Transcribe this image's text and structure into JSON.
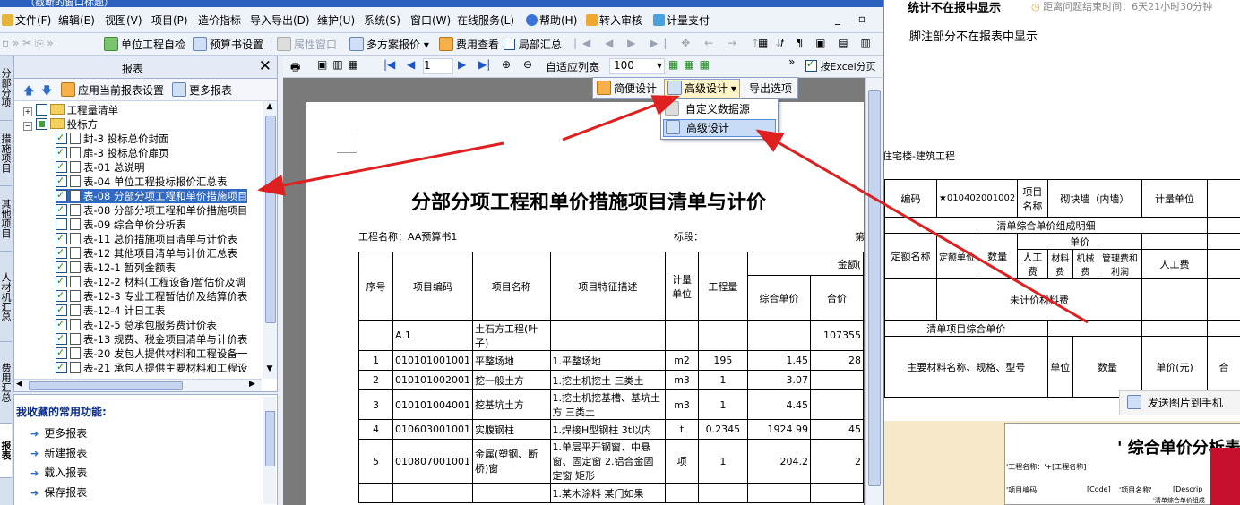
{
  "window": {
    "title": "（截断的窗口标题）"
  },
  "menu": {
    "items": [
      "文件(F)",
      "编辑(E)",
      "视图(V)",
      "项目(P)",
      "造价指标",
      "导入导出(D)",
      "维护(U)",
      "系统(S)",
      "窗口(W)",
      "在线服务(L)",
      "帮助(H)",
      "转入审核",
      "计量支付"
    ]
  },
  "toolbar1": {
    "unit_check": "单位工程自检",
    "budget_settings": "预算书设置",
    "attr_window": "属性窗口",
    "multi_quote": "多方案报价",
    "fee_view": "费用查看",
    "local_summary": "局部汇总"
  },
  "vtabs": [
    "分部分项",
    "措施项目",
    "其他项目",
    "人材机汇总",
    "费用汇总",
    "报表"
  ],
  "panel": {
    "title": "报表",
    "close": "✕",
    "apply_settings": "应用当前报表设置",
    "more_reports": "更多报表",
    "tree": [
      {
        "label": "工程量清单",
        "level": 0,
        "check": "none",
        "kind": "folder",
        "expander": "+"
      },
      {
        "label": "投标方",
        "level": 0,
        "check": "partial",
        "kind": "folder",
        "expander": "−"
      },
      {
        "label": "封-3 投标总价封面",
        "level": 1,
        "check": "on"
      },
      {
        "label": "扉-3 投标总价扉页",
        "level": 1,
        "check": "on"
      },
      {
        "label": "表-01 总说明",
        "level": 1,
        "check": "on"
      },
      {
        "label": "表-04 单位工程投标报价汇总表",
        "level": 1,
        "check": "on"
      },
      {
        "label": "表-08 分部分项工程和单价措施项目",
        "level": 1,
        "check": "on",
        "selected": true
      },
      {
        "label": "表-08 分部分项工程和单价措施项目",
        "level": 1,
        "check": "on"
      },
      {
        "label": "表-09 综合单价分析表",
        "level": 1,
        "check": "none"
      },
      {
        "label": "表-11 总价措施项目清单与计价表",
        "level": 1,
        "check": "on"
      },
      {
        "label": "表-12 其他项目清单与计价汇总表",
        "level": 1,
        "check": "on"
      },
      {
        "label": "表-12-1 暂列金额表",
        "level": 1,
        "check": "on"
      },
      {
        "label": "表-12-2 材料(工程设备)暂估价及调",
        "level": 1,
        "check": "on"
      },
      {
        "label": "表-12-3 专业工程暂估价及结算价表",
        "level": 1,
        "check": "on"
      },
      {
        "label": "表-12-4 计日工表",
        "level": 1,
        "check": "on"
      },
      {
        "label": "表-12-5 总承包服务费计价表",
        "level": 1,
        "check": "on"
      },
      {
        "label": "表-13 规费、税金项目清单与计价表",
        "level": 1,
        "check": "on"
      },
      {
        "label": "表-20 发包人提供材料和工程设备一",
        "level": 1,
        "check": "on"
      },
      {
        "label": "表-21 承包人提供主要材料和工程设",
        "level": 1,
        "check": "on"
      }
    ]
  },
  "favorites": {
    "heading": "我收藏的常用功能:",
    "items": [
      "更多报表",
      "新建报表",
      "载入报表",
      "保存报表"
    ]
  },
  "preview_toolbar": {
    "page": "1",
    "fit_width": "自适应列宽",
    "zoom": "100",
    "excel_page": "按Excel分页"
  },
  "dropdown": {
    "simple_design": "简便设计",
    "advanced_design": "高级设计",
    "export_options": "导出选项",
    "menu": [
      "自定义数据源",
      "高级设计"
    ]
  },
  "report": {
    "title": "分部分项工程和单价措施项目清单与计价",
    "project_label": "工程名称：AA预算书1",
    "section_label": "标段：",
    "page_label": "第",
    "amount_header": "金额(",
    "headers": [
      "序号",
      "项目编码",
      "项目名称",
      "项目特征描述",
      "计量单位",
      "工程量",
      "综合单价",
      "合价"
    ],
    "rows": [
      [
        "",
        "A.1",
        "土石方工程(叶子)",
        "",
        "",
        "",
        "",
        "107355"
      ],
      [
        "1",
        "010101001001",
        "平整场地",
        "1.平整场地",
        "m2",
        "195",
        "1.45",
        "28"
      ],
      [
        "2",
        "010101002001",
        "挖一般土方",
        "1.挖土机挖土 三类土",
        "m3",
        "1",
        "3.07",
        ""
      ],
      [
        "3",
        "010101004001",
        "挖基坑土方",
        "1.挖土机挖基槽、基坑土方 三类土",
        "m3",
        "1",
        "4.45",
        ""
      ],
      [
        "4",
        "010603001001",
        "实腹钢柱",
        "1.焊接H型钢柱 3t以内",
        "t",
        "0.2345",
        "1924.99",
        "45"
      ],
      [
        "5",
        "010807001001",
        "金属(塑钢、断桥)窗",
        "1.单层平开钢窗、中悬窗、固定窗 2.铝合金固定窗 矩形",
        "项",
        "1",
        "204.2",
        "2"
      ],
      [
        "",
        "",
        "",
        "1.某木涂料 某门如果",
        "",
        "",
        "",
        ""
      ]
    ]
  },
  "right": {
    "question_title": "统计不在报中显示",
    "timer_label": "距离问题结束时间：",
    "timer_value": "6天21小时30分钟",
    "note": "脚注部分不在报表中显示",
    "project_name": "住宅楼-建筑工程",
    "code_label": "编码",
    "code_value": "★010402001002",
    "item_name_label": "项目名称",
    "item_name_value": "砌块墙（内墙）",
    "unit_label": "计量单位",
    "detail_header": "清单综合单价组成明细",
    "quota_name": "定额名称",
    "quota_unit": "定额单位",
    "quantity": "数量",
    "unit_price": "单价",
    "labor": "人工费",
    "material": "材料费",
    "machine": "机械费",
    "mgmt": "管理费和利润",
    "labor2": "人工费",
    "unpriced": "未计价材料费",
    "composite_price": "清单项目综合单价",
    "main_material": "主要材料名称、规格、型号",
    "unit": "单位",
    "qty": "数量",
    "price_yuan": "单价(元)",
    "send_phone": "发送图片到手机",
    "subreport_title": "' 综合单价分析表",
    "sub_project": "'工程名称：'+[工程名称]",
    "sub_code": "'项目编码'",
    "sub_code_field": "[Code]",
    "sub_name": "'项目名称'",
    "sub_desc": "[Descrip",
    "sub_detail": "'清单综合单价组成"
  },
  "colors": {
    "accent": "#316ac5",
    "arrow": "#e02020",
    "title_bar": "#2b5fbf"
  }
}
